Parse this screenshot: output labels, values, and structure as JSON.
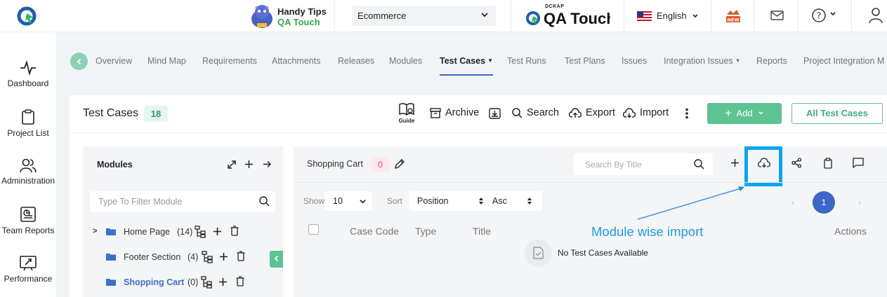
{
  "header": {
    "tips_line1": "Handy Tips",
    "tips_line2": "QA Touch",
    "project": "Ecommerce",
    "brand_small": "DCKAP",
    "brand_name": "QA Touch",
    "language": "English"
  },
  "leftnav": [
    "Dashboard",
    "Project List",
    "Administration",
    "Team Reports",
    "Performance"
  ],
  "tabs": [
    "Overview",
    "Mind Map",
    "Requirements",
    "Attachments",
    "Releases",
    "Modules",
    "Test Cases",
    "Test Runs",
    "Test Plans",
    "Issues",
    "Integration Issues",
    "Reports",
    "Project Integration M"
  ],
  "toolbar": {
    "title": "Test Cases",
    "count": "18",
    "guide": "Guide",
    "archive": "Archive",
    "search": "Search",
    "export": "Export",
    "import": "Import",
    "add": "Add",
    "all_test_cases": "All Test Cases"
  },
  "modules_panel": {
    "title": "Modules",
    "filter_placeholder": "Type To Filter Module",
    "items": [
      {
        "name": "Home Page",
        "count": "(14)"
      },
      {
        "name": "Footer Section",
        "count": "(4)"
      },
      {
        "name": "Shopping Cart",
        "count": "(0)"
      }
    ]
  },
  "cases_panel": {
    "module_name": "Shopping Cart",
    "module_count": "0",
    "search_placeholder": "Search By Title",
    "show_label": "Show",
    "show_value": "10",
    "sort_label": "Sort",
    "sort_value": "Position",
    "order_value": "Asc",
    "page": "1",
    "columns": {
      "code": "Case Code",
      "type": "Type",
      "title": "Title",
      "actions": "Actions"
    },
    "empty": "No Test Cases Available",
    "annotation": "Module wise import"
  },
  "colors": {
    "accent_green": "#5cc392",
    "highlight_blue": "#0aa5f0",
    "page_blue": "#3c66c8"
  }
}
